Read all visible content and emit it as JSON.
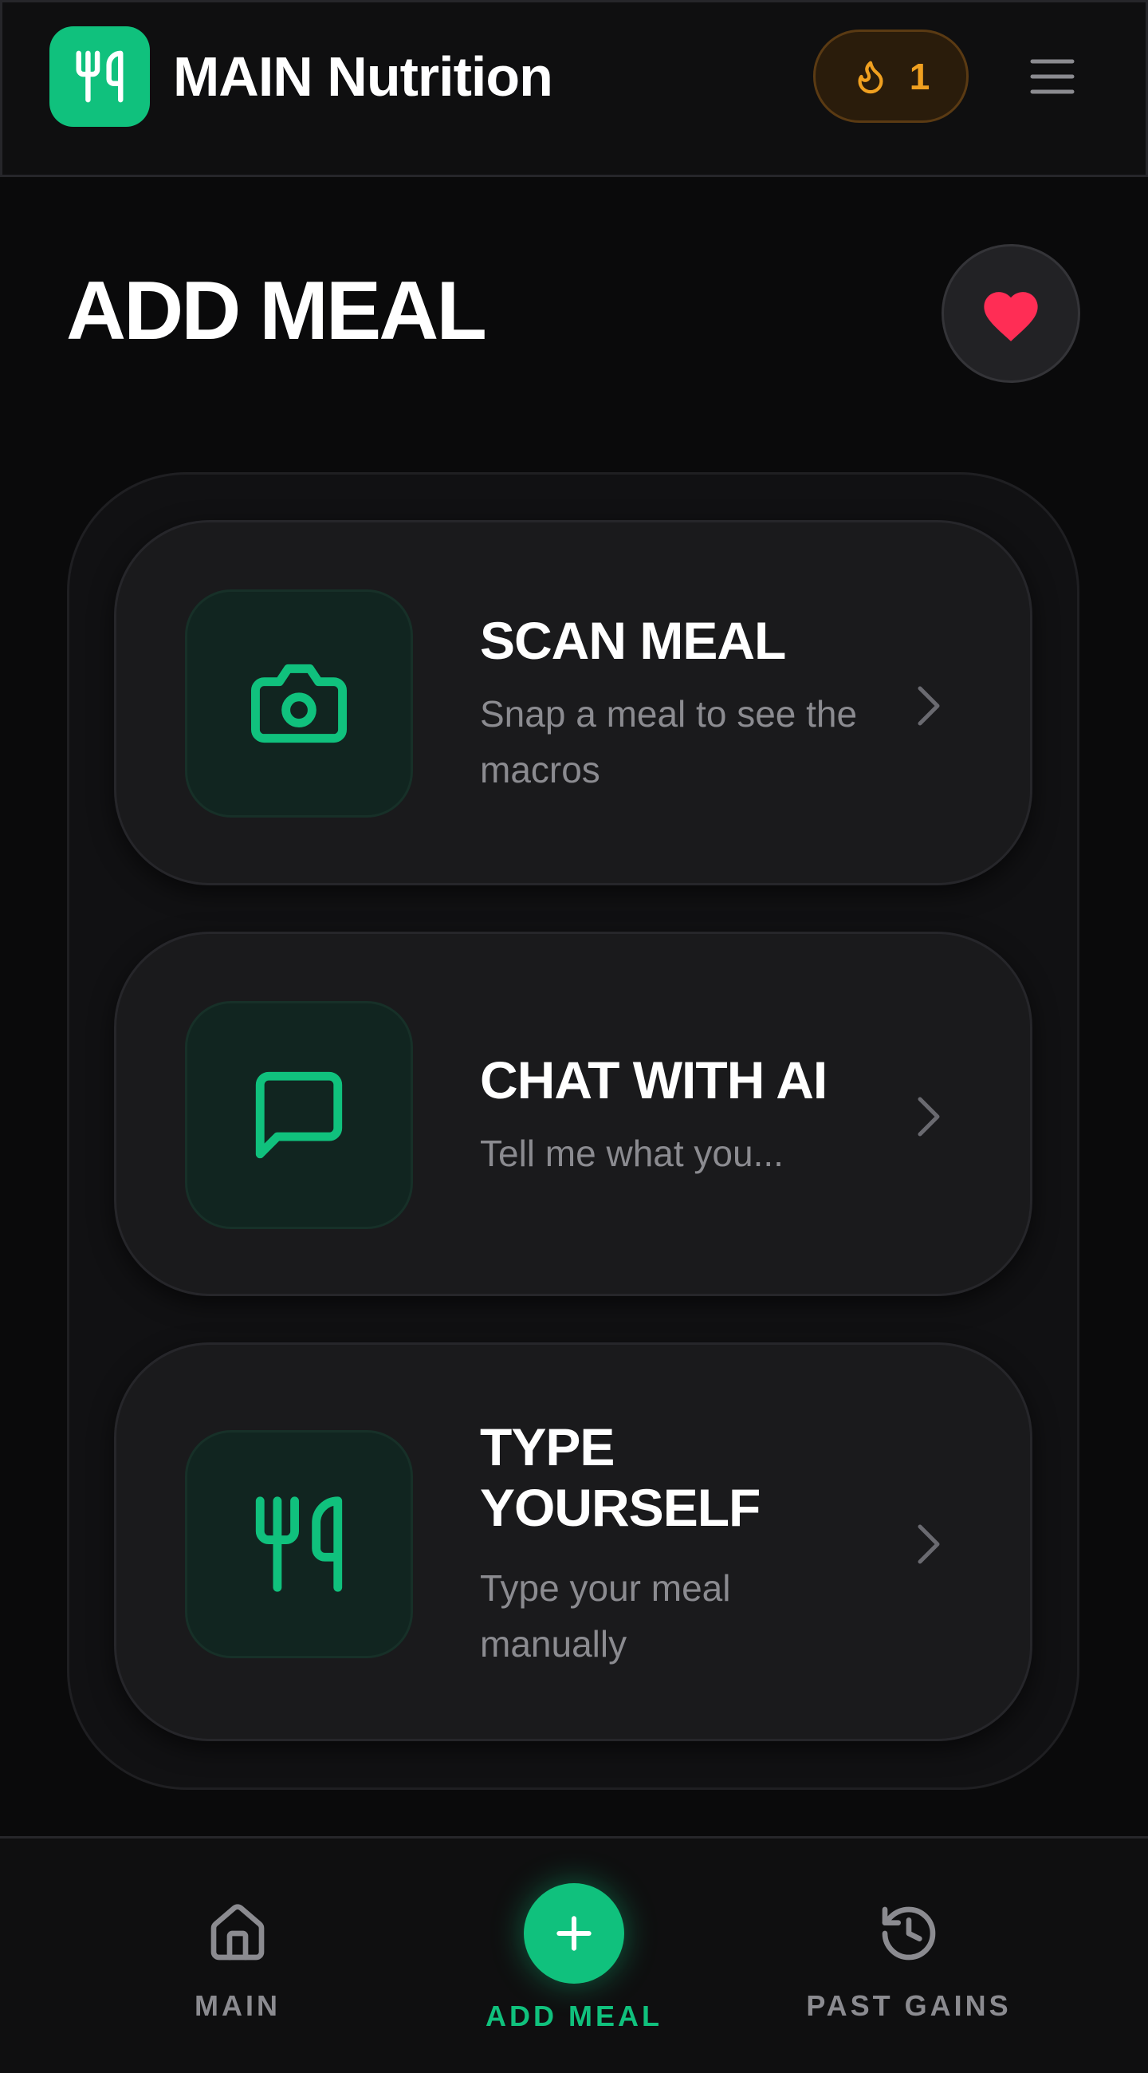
{
  "header": {
    "app_title": "MAIN Nutrition",
    "logo_icon": "fork-knife-icon",
    "streak": {
      "icon": "flame-icon",
      "count": "1"
    },
    "menu_icon": "hamburger-menu-icon"
  },
  "page": {
    "title": "ADD MEAL",
    "favorite_icon": "heart-icon"
  },
  "options": [
    {
      "icon": "camera-icon",
      "title": "SCAN MEAL",
      "description": "Snap a meal to see the macros"
    },
    {
      "icon": "chat-bubble-icon",
      "title": "CHAT WITH AI",
      "description": "Tell me what you..."
    },
    {
      "icon": "fork-knife-icon",
      "title": "TYPE YOURSELF",
      "description": "Type your meal manually"
    }
  ],
  "bottom_nav": {
    "items": [
      {
        "icon": "home-icon",
        "label": "MAIN"
      },
      {
        "icon": "plus-icon",
        "label": "ADD MEAL",
        "active": true
      },
      {
        "icon": "history-icon",
        "label": "PAST GAINS"
      }
    ]
  },
  "colors": {
    "accent": "#10c17d",
    "streak": "#f0a020",
    "heart": "#ff2d55",
    "background": "#0a0a0b",
    "card": "#1a1a1c",
    "muted_text": "#8b8b90"
  }
}
